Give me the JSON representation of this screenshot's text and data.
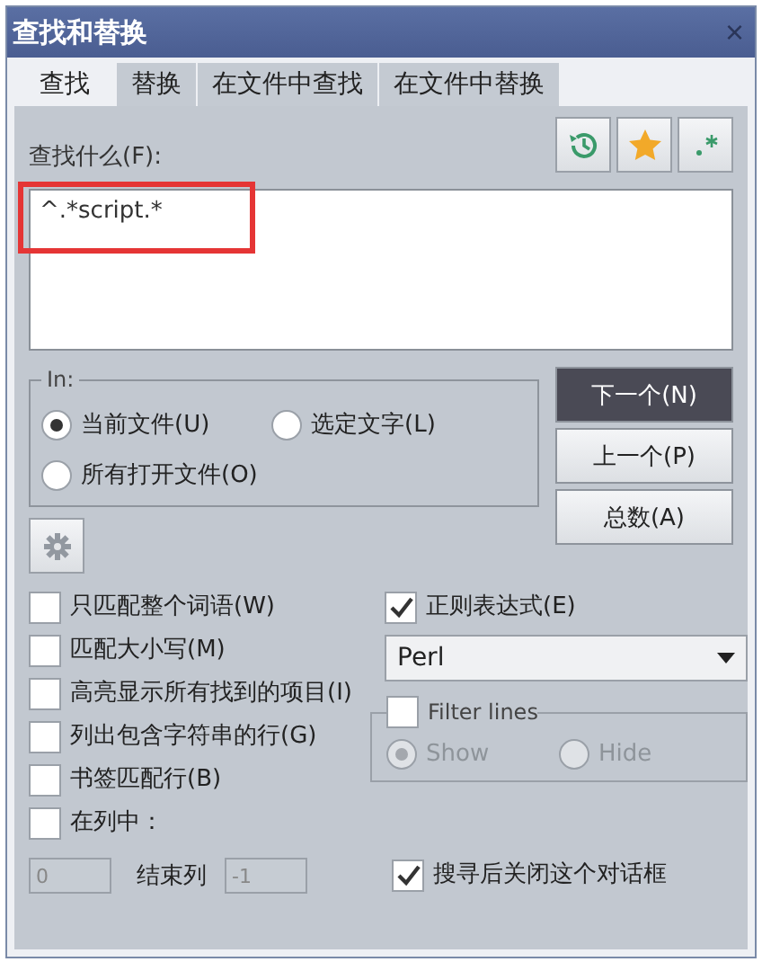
{
  "window": {
    "title": "查找和替换",
    "close": "×"
  },
  "tabs": [
    {
      "label": "查找",
      "selected": true
    },
    {
      "label": "替换",
      "selected": false
    },
    {
      "label": "在文件中查找",
      "selected": false
    },
    {
      "label": "在文件中替换",
      "selected": false
    }
  ],
  "find": {
    "label": "查找什么(F):",
    "value": "^.*script.*"
  },
  "scope": {
    "legend": "In:",
    "options": [
      {
        "label": "当前文件(U)",
        "selected": true
      },
      {
        "label": "选定文字(L)",
        "selected": false
      },
      {
        "label": "所有打开文件(O)",
        "selected": false
      }
    ]
  },
  "actions": [
    {
      "label": "下一个(N)",
      "primary": true
    },
    {
      "label": "上一个(P)",
      "primary": false
    },
    {
      "label": "总数(A)",
      "primary": false
    }
  ],
  "options": [
    {
      "label": "只匹配整个词语(W)",
      "checked": false
    },
    {
      "label": "匹配大小写(M)",
      "checked": false
    },
    {
      "label": "高亮显示所有找到的项目(I)",
      "checked": false
    },
    {
      "label": "列出包含字符串的行(G)",
      "checked": false
    },
    {
      "label": "书签匹配行(B)",
      "checked": false
    },
    {
      "label": "在列中：",
      "checked": false
    }
  ],
  "regex": {
    "label": "正则表达式(E)",
    "checked": true,
    "engine": "Perl"
  },
  "filter": {
    "label": "Filter lines",
    "checked": false,
    "disabled": true,
    "options": [
      {
        "label": "Show",
        "selected": true
      },
      {
        "label": "Hide",
        "selected": false
      }
    ]
  },
  "columns": {
    "start": "0",
    "end_label": "结束列",
    "end": "-1",
    "disabled": true
  },
  "close_after": {
    "label": "搜寻后关闭这个对话框",
    "checked": true
  }
}
